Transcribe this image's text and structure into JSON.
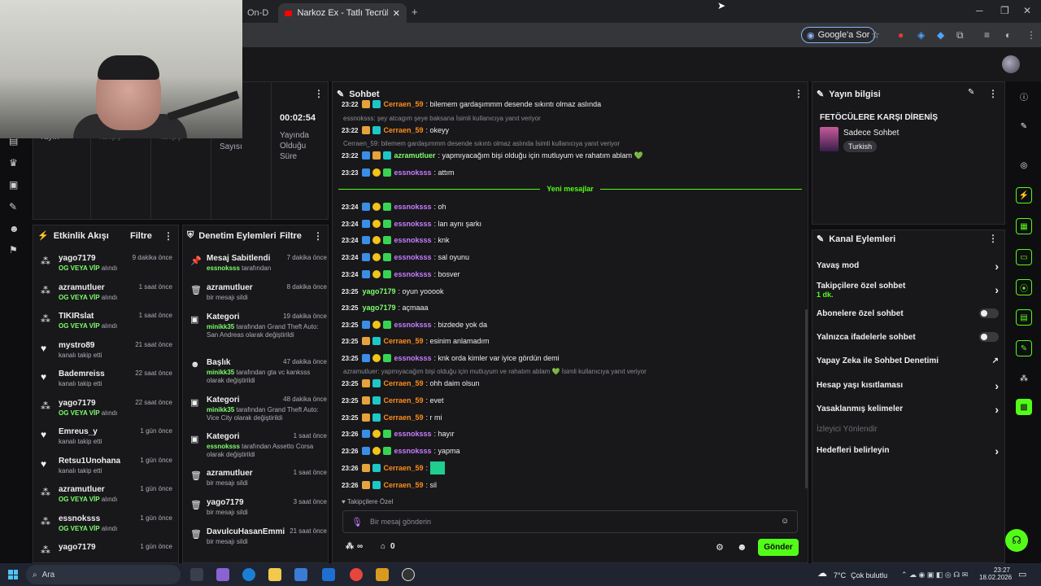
{
  "browser": {
    "tabs": [
      {
        "label": "On-D"
      },
      {
        "label": "Narkoz Ex - Tatlı Tecrübe ( Offici"
      }
    ],
    "new_tab": "+",
    "ask_google": "Google'a Sor"
  },
  "stats": {
    "cells": [
      {
        "label": "Yayın"
      },
      {
        "label": "Takipçi"
      },
      {
        "label": "Takipçi"
      },
      {
        "label": "Sayısı"
      }
    ],
    "uptime_value": "00:02:54",
    "uptime_label": "Yayında Olduğu Süre"
  },
  "activity": {
    "title": "Etkinlik Akışı",
    "filter": "Filtre",
    "items": [
      {
        "icon": "vip-icon",
        "name": "yago7179",
        "sub_highlight": "OG VEYA VİP",
        "sub": " alındı",
        "time": "9 dakika önce"
      },
      {
        "icon": "vip-icon",
        "name": "azramutluer",
        "sub_highlight": "OG VEYA VİP",
        "sub": " alındı",
        "time": "1 saat önce"
      },
      {
        "icon": "vip-icon",
        "name": "TIKIRslat",
        "sub_highlight": "OG VEYA VİP",
        "sub": " alındı",
        "time": "1 saat önce"
      },
      {
        "icon": "heart-icon",
        "name": "mystro89",
        "sub_highlight": "",
        "sub": "kanalı takip etti",
        "time": "21 saat önce"
      },
      {
        "icon": "heart-icon",
        "name": "Bademreiss",
        "sub_highlight": "",
        "sub": "kanalı takip etti",
        "time": "22 saat önce"
      },
      {
        "icon": "vip-icon",
        "name": "yago7179",
        "sub_highlight": "OG VEYA VİP",
        "sub": " alındı",
        "time": "22 saat önce"
      },
      {
        "icon": "heart-icon",
        "name": "Emreus_y",
        "sub_highlight": "",
        "sub": "kanalı takip etti",
        "time": "1 gün önce"
      },
      {
        "icon": "heart-icon",
        "name": "Retsu1Unohana",
        "sub_highlight": "",
        "sub": "kanalı takip etti",
        "time": "1 gün önce"
      },
      {
        "icon": "vip-icon",
        "name": "azramutluer",
        "sub_highlight": "OG VEYA VİP",
        "sub": " alındı",
        "time": "1 gün önce"
      },
      {
        "icon": "vip-icon",
        "name": "essnoksss",
        "sub_highlight": "OG VEYA VİP",
        "sub": " alındı",
        "time": "1 gün önce"
      },
      {
        "icon": "vip-icon",
        "name": "yago7179",
        "sub_highlight": "",
        "sub": "",
        "time": "1 gün önce"
      }
    ]
  },
  "moderation": {
    "title": "Denetim Eylemleri",
    "filter": "Filtre",
    "items": [
      {
        "icon": "pin-icon",
        "name": "Mesaj Sabitlendi",
        "time": "7 dakika önce",
        "hl": "essnoksss",
        "sub": " tarafından"
      },
      {
        "icon": "trash-icon",
        "name": "azramutluer",
        "time": "8 dakika önce",
        "hl": "",
        "sub": "bir mesajı sildi"
      },
      {
        "icon": "category-icon",
        "name": "Kategori",
        "time": "19 dakika önce",
        "hl": "minikk35",
        "sub": " tarafından Grand Theft Auto: San Andreas olarak değiştirildi"
      },
      {
        "icon": "title-icon",
        "name": "Başlık",
        "time": "47 dakika önce",
        "hl": "minikk35",
        "sub": " tarafından gta vc kanksss olarak değiştirildi"
      },
      {
        "icon": "category-icon",
        "name": "Kategori",
        "time": "48 dakika önce",
        "hl": "minikk35",
        "sub": " tarafından Grand Theft Auto: Vice City olarak değiştirildi"
      },
      {
        "icon": "category-icon",
        "name": "Kategori",
        "time": "1 saat önce",
        "hl": "essnoksss",
        "sub": " tarafından Assetto Corsa olarak değiştirildi"
      },
      {
        "icon": "trash-icon",
        "name": "azramutluer",
        "time": "1 saat önce",
        "hl": "",
        "sub": "bir mesajı sildi"
      },
      {
        "icon": "trash-icon",
        "name": "yago7179",
        "time": "3 saat önce",
        "hl": "",
        "sub": "bir mesajı sildi"
      },
      {
        "icon": "trash-icon",
        "name": "DavulcuHasanEmmi",
        "time": "21 saat önce",
        "hl": "",
        "sub": "bir mesajı sildi"
      }
    ]
  },
  "chat": {
    "title": "Sohbet",
    "new_messages": "Yeni mesajlar",
    "followers_only": "Takipçilere Özel",
    "placeholder": "Bir mesaj gönderin",
    "points": "∞",
    "count": "0",
    "send": "Gönder",
    "messages": [
      {
        "type": "msg",
        "time": "23:22",
        "badges": [
          "b-crown",
          "b-cyan"
        ],
        "user": "Cerraen_59",
        "color": "#ff8c1a",
        "text": ": bilemem gardaşımmm desende sıkıntı olmaz aslında"
      },
      {
        "type": "reply",
        "text": "essnoksss: şey atcagım şeye baksana İsimli kullanıcıya yanıt veriyor"
      },
      {
        "type": "msg",
        "time": "23:22",
        "badges": [
          "b-crown",
          "b-cyan"
        ],
        "user": "Cerraen_59",
        "color": "#ff8c1a",
        "text": ": okeyy"
      },
      {
        "type": "reply",
        "text": "Cerraen_59: bilemem gardaşımmm desende sıkıntı olmaz aslında İsimli kullanıcıya yanıt veriyor"
      },
      {
        "type": "msg",
        "time": "23:22",
        "badges": [
          "b-blue",
          "b-crown",
          "b-cyan"
        ],
        "user": "azramutluer",
        "color": "#7dff6b",
        "text": ": yapmıyacağım bişi olduğu için mutluyum ve rahatım ablam 💚"
      },
      {
        "type": "msg",
        "time": "23:23",
        "badges": [
          "b-blue",
          "b-sub",
          "b-grn"
        ],
        "user": "essnoksss",
        "color": "#c77dff",
        "text": ": attım"
      },
      {
        "type": "divider"
      },
      {
        "type": "msg",
        "time": "23:24",
        "badges": [
          "b-blue",
          "b-sub",
          "b-grn"
        ],
        "user": "essnoksss",
        "color": "#c77dff",
        "text": ": oh"
      },
      {
        "type": "msg",
        "time": "23:24",
        "badges": [
          "b-blue",
          "b-sub",
          "b-grn"
        ],
        "user": "essnoksss",
        "color": "#c77dff",
        "text": ": lan aynı şarkı"
      },
      {
        "type": "msg",
        "time": "23:24",
        "badges": [
          "b-blue",
          "b-sub",
          "b-grn"
        ],
        "user": "essnoksss",
        "color": "#c77dff",
        "text": ": knk"
      },
      {
        "type": "msg",
        "time": "23:24",
        "badges": [
          "b-blue",
          "b-sub",
          "b-grn"
        ],
        "user": "essnoksss",
        "color": "#c77dff",
        "text": ": sal oyunu"
      },
      {
        "type": "msg",
        "time": "23:24",
        "badges": [
          "b-blue",
          "b-sub",
          "b-grn"
        ],
        "user": "essnoksss",
        "color": "#c77dff",
        "text": ": bosver"
      },
      {
        "type": "msg",
        "time": "23:25",
        "badges": [],
        "user": "yago7179",
        "color": "#7dff6b",
        "text": ": oyun yooook"
      },
      {
        "type": "msg",
        "time": "23:25",
        "badges": [],
        "user": "yago7179",
        "color": "#7dff6b",
        "text": ": açmaaa"
      },
      {
        "type": "msg",
        "time": "23:25",
        "badges": [
          "b-blue",
          "b-sub",
          "b-grn"
        ],
        "user": "essnoksss",
        "color": "#c77dff",
        "text": ": bizdede yok da"
      },
      {
        "type": "msg",
        "time": "23:25",
        "badges": [
          "b-crown",
          "b-cyan"
        ],
        "user": "Cerraen_59",
        "color": "#ff8c1a",
        "text": ": esinim anlamadım"
      },
      {
        "type": "msg",
        "time": "23:25",
        "badges": [
          "b-blue",
          "b-sub",
          "b-grn"
        ],
        "user": "essnoksss",
        "color": "#c77dff",
        "text": ": knk orda kimler var iyice gördün demi"
      },
      {
        "type": "reply",
        "text": "azramutluer: yapmıyacağım bişi olduğu için mutluyum ve rahatım ablam 💚 İsimli kullanıcıya yanıt veriyor"
      },
      {
        "type": "msg",
        "time": "23:25",
        "badges": [
          "b-crown",
          "b-cyan"
        ],
        "user": "Cerraen_59",
        "color": "#ff8c1a",
        "text": ": ohh daim olsun"
      },
      {
        "type": "msg",
        "time": "23:25",
        "badges": [
          "b-crown",
          "b-cyan"
        ],
        "user": "Cerraen_59",
        "color": "#ff8c1a",
        "text": ": evet"
      },
      {
        "type": "msg",
        "time": "23:25",
        "badges": [
          "b-crown",
          "b-cyan"
        ],
        "user": "Cerraen_59",
        "color": "#ff8c1a",
        "text": ": r mi"
      },
      {
        "type": "msg",
        "time": "23:26",
        "badges": [
          "b-blue",
          "b-sub",
          "b-grn"
        ],
        "user": "essnoksss",
        "color": "#c77dff",
        "text": ": hayır"
      },
      {
        "type": "msg",
        "time": "23:26",
        "badges": [
          "b-blue",
          "b-sub",
          "b-grn"
        ],
        "user": "essnoksss",
        "color": "#c77dff",
        "text": ": yapma"
      },
      {
        "type": "msg",
        "time": "23:26",
        "badges": [
          "b-crown",
          "b-cyan"
        ],
        "user": "Cerraen_59",
        "color": "#ff8c1a",
        "text": ": ",
        "emote": true
      },
      {
        "type": "msg",
        "time": "23:26",
        "badges": [
          "b-crown",
          "b-cyan"
        ],
        "user": "Cerraen_59",
        "color": "#ff8c1a",
        "text": ": sil"
      }
    ]
  },
  "stream_info": {
    "title": "Yayın bilgisi",
    "stream_title": "FETÖCÜLERE KARŞI DİRENİŞ",
    "category": "Sadece Sohbet",
    "language": "Turkish"
  },
  "channel_actions": {
    "title": "Kanal Eylemleri",
    "items": [
      {
        "label": "Yavaş mod",
        "control": "chevron"
      },
      {
        "label": "Takipçilere özel sohbet",
        "sub": "1 dk.",
        "control": "chevron"
      },
      {
        "label": "Abonelere özel sohbet",
        "control": "toggle"
      },
      {
        "label": "Yalnızca ifadelerle sohbet",
        "control": "toggle"
      },
      {
        "label": "Yapay Zeka ile Sohbet Denetimi",
        "control": "external"
      },
      {
        "label": "Hesap yaşı kısıtlaması",
        "control": "chevron"
      },
      {
        "label": "Yasaklanmış kelimeler",
        "control": "chevron"
      },
      {
        "label": "İzleyici Yönlendir",
        "control": "none",
        "disabled": true
      },
      {
        "label": "Hedefleri belirleyin",
        "control": "chevron"
      }
    ]
  },
  "taskbar": {
    "search": "Ara",
    "weather_temp": "7°C",
    "weather_text": "Çok bulutlu",
    "time": "23:27",
    "date": "18.02.2026"
  },
  "colors": {
    "accent": "#53fc18",
    "bg": "#0e0e10",
    "panel": "#18181b"
  }
}
